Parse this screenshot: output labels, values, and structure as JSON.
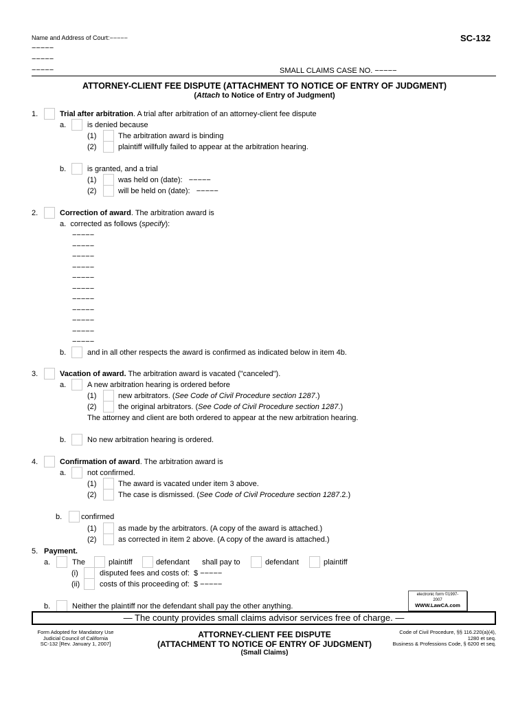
{
  "header": {
    "court_label": "Name and Address of Court:",
    "blank": "−−−−−",
    "form_number": "SC-132",
    "case_no_label": "SMALL CLAIMS CASE NO.",
    "title": "ATTORNEY-CLIENT FEE DISPUTE (ATTACHMENT TO NOTICE OF ENTRY OF JUDGMENT)",
    "subtitle_open": "(",
    "subtitle_attach": "Attach",
    "subtitle_rest": " to Notice of Entry of Judgment)"
  },
  "item1": {
    "num": "1.",
    "heading": "Trial after arbitration",
    "text": ".  A trial after arbitration of an attorney-client fee dispute",
    "a_label": "a.",
    "a_text": "is denied because",
    "a1_label": "(1)",
    "a1_text": "The arbitration award is binding",
    "a2_label": "(2)",
    "a2_text": "plaintiff willfully failed to appear at the arbitration hearing.",
    "b_label": "b.",
    "b_text": "is granted, and a trial",
    "b1_label": "(1)",
    "b1_text": " was held on (date):",
    "b2_label": "(2)",
    "b2_text": "will be held on (date):",
    "blank": "−−−−−"
  },
  "item2": {
    "num": "2.",
    "heading": "Correction of award",
    "text": ".  The arbitration award is",
    "a_label": "a.",
    "a_text_pre": "corrected as follows (",
    "a_text_ital": "specify",
    "a_text_post": "):",
    "blank_lines": [
      "−−−−−",
      "−−−−−",
      "−−−−−",
      "−−−−−",
      "−−−−−",
      "−−−−−",
      "−−−−−",
      "−−−−−",
      "−−−−−",
      "−−−−−",
      "−−−−−"
    ],
    "b_label": "b.",
    "b_text": "and in all other respects the award is confirmed as indicated below in item 4b."
  },
  "item3": {
    "num": "3.",
    "heading": "Vacation of award.",
    "text": " The arbitration award is vacated (\"canceled\").",
    "a_label": "a.",
    "a_text": "A new arbitration hearing is ordered before",
    "a1_label": "(1)",
    "a1_text": "new arbitrators. (",
    "a1_ital": "See Code of Civil Procedure section 1287",
    "a1_end": ".)",
    "a2_label": "(2)",
    "a2_text": "the original arbitrators. (",
    "a2_ital": "See Code of Civil Procedure section 1287",
    "a2_end": ".)",
    "note": "The attorney and client are both ordered to appear at the new arbitration hearing.",
    "b_label": "b.",
    "b_text": "No new arbitration hearing is ordered."
  },
  "item4": {
    "num": "4.",
    "heading": "Confirmation of award",
    "text": ". The arbitration award is",
    "a_label": "a.",
    "a_text": "not confirmed.",
    "a1_label": "(1)",
    "a1_text": "The award is vacated under item 3 above.",
    "a2_label": "(2)",
    "a2_text": "The case is dismissed. (",
    "a2_ital": "See Code of Civil Procedure section 1287",
    "a2_end": ".2.)",
    "b_label": "b.",
    "b_text": "confirmed",
    "b1_label": "(1)",
    "b1_text": "as made by the arbitrators. (A copy of the award is attached.)",
    "b2_label": "(2)",
    "b2_text": "as corrected in item 2 above. (A copy of the award is attached.)"
  },
  "item5": {
    "num": "5.",
    "heading": "Payment.",
    "a_label": "a.",
    "the": "The",
    "plaintiff": "plaintiff",
    "defendant": "defendant",
    "shall_pay_to": "shall pay to",
    "i_label": "(i)",
    "i_text": "disputed fees and costs of:",
    "ii_label": "(ii)",
    "ii_text": "costs of this proceeding of:",
    "dollar": "$",
    "blank": "−−−−−",
    "b_label": "b.",
    "b_text": "Neither the plaintiff nor the defendant shall pay the other anything."
  },
  "stamp": {
    "line1": "electronic form ©1997-",
    "line2": "2007",
    "line3": "WWW.LawCA.com"
  },
  "advisor_notice": "— The county provides small claims advisor services free of charge. —",
  "footer": {
    "left1": "Form Adopted for Mandatory Use",
    "left2": "Judicial Council of California",
    "left3": "SC-132 [Rev. January 1, 2007]",
    "center1": "ATTORNEY-CLIENT FEE DISPUTE",
    "center2": "(ATTACHMENT TO NOTICE OF ENTRY OF JUDGMENT)",
    "center3": "(Small Claims)",
    "right1": "Code of Civil Procedure, §§ 116.220(a)(4),",
    "right2": "1280 et seq.",
    "right3": "Business & Professions Code, § 6200 et seq."
  }
}
